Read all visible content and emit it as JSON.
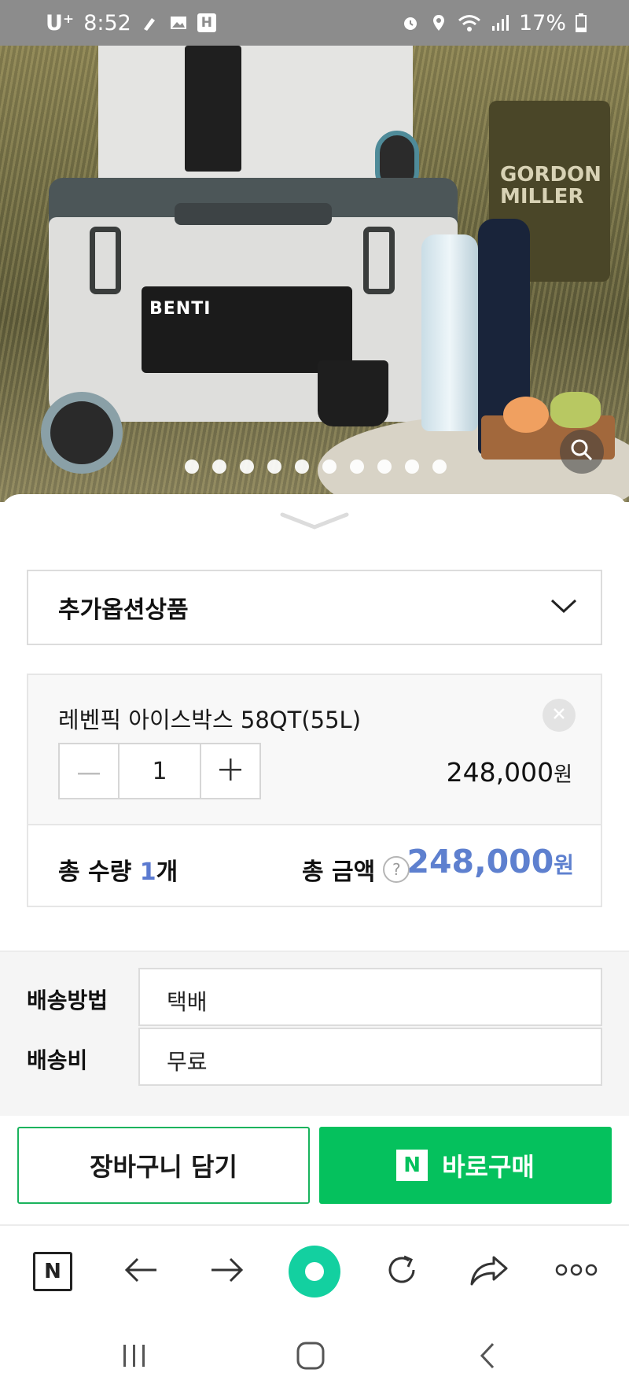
{
  "status_bar": {
    "carrier": "U⁺",
    "time": "8:52",
    "battery": "17%",
    "left_icons": [
      "pen-icon",
      "gallery-icon",
      "h-icon"
    ],
    "right_icons": [
      "alarm-icon",
      "location-icon",
      "wifi-icon",
      "signal-icon",
      "battery-icon"
    ],
    "h_badge": "H"
  },
  "hero": {
    "slide_count": 10,
    "active_slide": 1,
    "brand_text": "BENTI",
    "can_text": "GORDON MILLER",
    "zoom_icon": "search-icon"
  },
  "sheet": {
    "collapse_icon": "chevron-down-icon",
    "addon_select": {
      "label": "추가옵션상품",
      "icon": "chevron-down-icon"
    },
    "product": {
      "name": "레벤픽 아이스박스 58QT(55L)",
      "quantity": "1",
      "price": "248,000",
      "price_unit": "원",
      "remove_icon": "close-icon",
      "minus_icon": "minus-icon",
      "plus_icon": "plus-icon"
    },
    "totals": {
      "qty_label_prefix": "총 수량 ",
      "qty_value": "1",
      "qty_label_suffix": "개",
      "amount_label": "총 금액",
      "help_icon": "?",
      "amount": "248,000",
      "amount_unit": "원"
    },
    "shipping": {
      "method_label": "배송방법",
      "method_value": "택배",
      "fee_label": "배송비",
      "fee_value": "무료"
    },
    "actions": {
      "cart_label": "장바구니 담기",
      "buy_label": "바로구매",
      "npay_glyph": "N"
    }
  },
  "browser_toolbar": {
    "home_glyph": "N",
    "icons": [
      "naver-home-icon",
      "back-arrow-icon",
      "forward-arrow-icon",
      "green-dot-icon",
      "refresh-icon",
      "share-icon",
      "more-icon"
    ]
  },
  "colors": {
    "accent_blue": "#5e80cf",
    "buy_green": "#05c15d",
    "status_bar": "#8c8c8c"
  }
}
